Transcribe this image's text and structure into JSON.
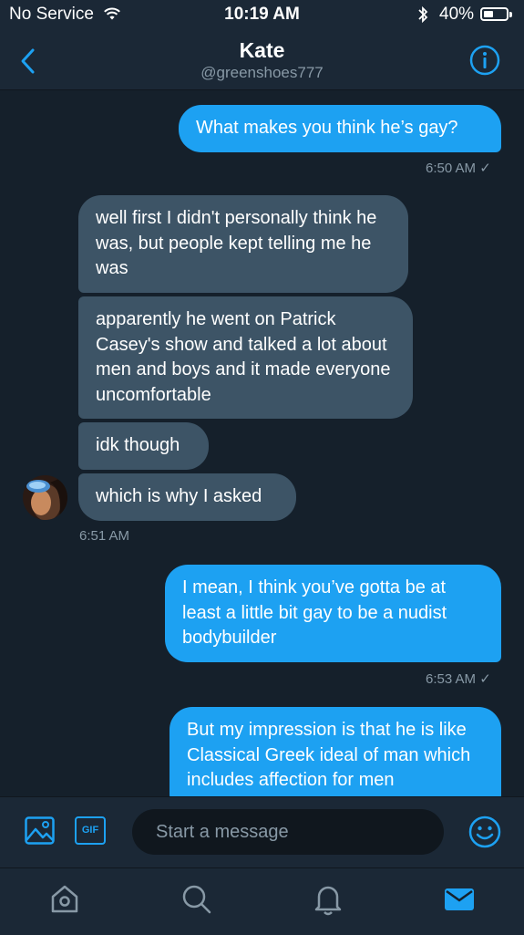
{
  "status_bar": {
    "carrier": "No Service",
    "time": "10:19 AM",
    "battery": "40%",
    "battery_level": 0.4
  },
  "header": {
    "title": "Kate",
    "handle": "@greenshoes777"
  },
  "messages": [
    {
      "side": "out",
      "text": "What makes you think he’s gay?"
    },
    {
      "side": "out_time",
      "text": "6:50 AM ✓"
    },
    {
      "side": "in",
      "text": "well first I didn't personally think he was, but people kept telling me he was"
    },
    {
      "side": "in",
      "text": "apparently he went on Patrick Casey's show and talked a lot about men and boys and it made everyone uncomfortable"
    },
    {
      "side": "in",
      "text": "idk though"
    },
    {
      "side": "in",
      "text": "which is why I asked"
    },
    {
      "side": "in_time",
      "text": "6:51 AM"
    },
    {
      "side": "out",
      "text": "I mean, I think you’ve gotta be at least a little bit gay to be a nudist bodybuilder"
    },
    {
      "side": "out_time",
      "text": "6:53 AM ✓"
    },
    {
      "side": "out",
      "text": "But my impression is that he is like Classical Greek ideal of man which includes affection for men"
    }
  ],
  "composer": {
    "placeholder": "Start a message",
    "gif_label": "GIF"
  },
  "icons": {
    "back": "chevron-left-icon",
    "info": "info-icon",
    "image": "image-icon",
    "emoji": "emoji-icon",
    "tabs": [
      "home-icon",
      "search-icon",
      "notifications-icon",
      "messages-icon"
    ]
  },
  "colors": {
    "accent": "#1da1f2",
    "background": "#15202b",
    "bar": "#1b2836",
    "incoming_bubble": "#3d5466",
    "secondary_text": "#8899a6"
  }
}
